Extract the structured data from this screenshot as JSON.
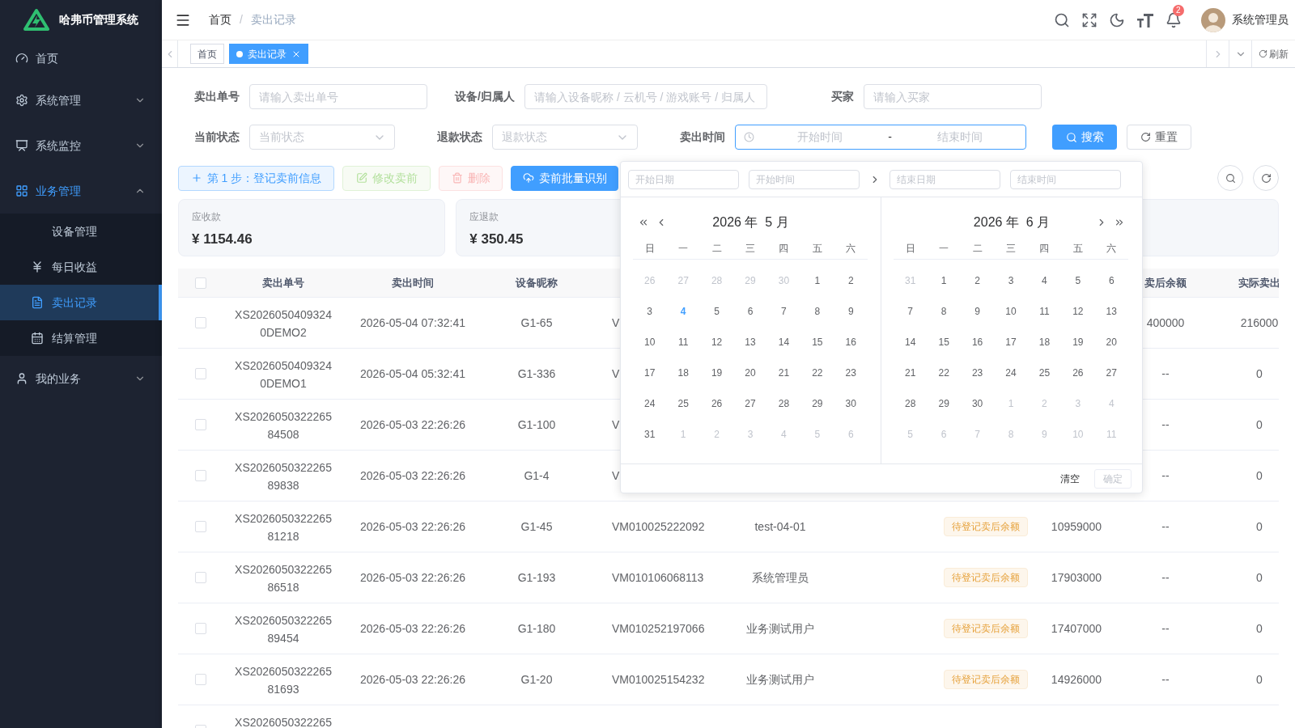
{
  "sidebar": {
    "title": "哈弗币管理系统",
    "items": [
      {
        "label": "首页",
        "selected": false
      },
      {
        "label": "系统管理",
        "selected": false,
        "expanded": false
      },
      {
        "label": "系统监控",
        "selected": false,
        "expanded": false
      },
      {
        "label": "业务管理",
        "selected": false,
        "expanded": true,
        "children": [
          {
            "label": "设备管理",
            "selected": false
          },
          {
            "label": "每日收益",
            "selected": false
          },
          {
            "label": "卖出记录",
            "selected": true
          },
          {
            "label": "结算管理",
            "selected": false
          }
        ]
      },
      {
        "label": "我的业务",
        "selected": false,
        "expanded": false
      }
    ]
  },
  "header": {
    "breadcrumb": [
      "首页",
      "卖出记录"
    ],
    "breadcrumb_separator": "/",
    "notifications": "2",
    "user": "系统管理员"
  },
  "tabs": [
    {
      "label": "首页",
      "selected": false
    },
    {
      "label": "卖出记录",
      "selected": true
    }
  ],
  "refresh": "刷新",
  "filters": [
    {
      "label": "卖出单号",
      "kind": "input",
      "placeholder": "请输入卖出单号"
    },
    {
      "label": "设备/归属人",
      "kind": "input",
      "placeholder": "请输入设备昵称 / 云机号 / 游戏账号 / 归属人"
    },
    {
      "label": "买家",
      "kind": "input",
      "placeholder": "请输入买家"
    },
    {
      "label": "当前状态",
      "kind": "select",
      "placeholder": "当前状态"
    },
    {
      "label": "退款状态",
      "kind": "select",
      "placeholder": "退款状态"
    },
    {
      "label": "卖出时间",
      "kind": "daterange",
      "start_placeholder": "开始时间",
      "separator": "-",
      "end_placeholder": "结束时间",
      "focused": true
    }
  ],
  "search_button": "搜索",
  "reset_button": "重置",
  "actions": [
    {
      "label": "第 1 步：登记卖前信息",
      "kind": "plain",
      "disabled": false
    },
    {
      "label": "修改卖前",
      "kind": "success",
      "disabled": true
    },
    {
      "label": "删除",
      "kind": "danger",
      "disabled": true
    },
    {
      "label": "卖前批量识别",
      "kind": "primary",
      "disabled": false
    }
  ],
  "stats": [
    {
      "kind": "value",
      "label": "应收款",
      "value": "¥ 1154.46"
    },
    {
      "kind": "value",
      "label": "应退款",
      "value": "¥ 350.45"
    },
    {
      "kind": "blank"
    }
  ],
  "table": {
    "columns": {
      "order_no": "卖出单号",
      "sale_time": "卖出时间",
      "device_name": "设备昵称",
      "balance_after_sale": "卖后余额",
      "column_9": "实际卖出"
    },
    "header_checked": false,
    "rows": [
      {
        "checked": false,
        "order_no": "XS20260504093240DEMO2",
        "sale_time": "2026-05-04 07:32:41",
        "device_name": "G1-65",
        "column_4": "V",
        "balance_after_sale": "400000",
        "column_9": "216000"
      },
      {
        "checked": false,
        "order_no": "XS20260504093240DEMO1",
        "sale_time": "2026-05-04 05:32:41",
        "device_name": "G1-336",
        "column_4": "V",
        "balance_after_sale": "--",
        "column_9": "0"
      },
      {
        "checked": false,
        "order_no": "XS202605032226584508",
        "sale_time": "2026-05-03 22:26:26",
        "device_name": "G1-100",
        "column_4": "V",
        "balance_after_sale": "--",
        "column_9": "0"
      },
      {
        "checked": false,
        "order_no": "XS202605032226589838",
        "sale_time": "2026-05-03 22:26:26",
        "device_name": "G1-4",
        "column_4": "V",
        "balance_after_sale": "--",
        "column_9": "0"
      },
      {
        "checked": false,
        "order_no": "XS202605032226581218",
        "sale_time": "2026-05-03 22:26:26",
        "device_name": "G1-45",
        "column_4": "VM010025222092",
        "column_5": "test-04-01",
        "column_6": "待登记卖后余额",
        "column_7": "10959000",
        "balance_after_sale": "--",
        "column_9": "0"
      },
      {
        "checked": false,
        "order_no": "XS202605032226586518",
        "sale_time": "2026-05-03 22:26:26",
        "device_name": "G1-193",
        "column_4": "VM010106068113",
        "column_5": "系统管理员",
        "column_6": "待登记卖后余额",
        "column_7": "17903000",
        "balance_after_sale": "--",
        "column_9": "0"
      },
      {
        "checked": false,
        "order_no": "XS202605032226589454",
        "sale_time": "2026-05-03 22:26:26",
        "device_name": "G1-180",
        "column_4": "VM010252197066",
        "column_5": "业务测试用户",
        "column_6": "待登记卖后余额",
        "column_7": "17407000",
        "balance_after_sale": "--",
        "column_9": "0"
      },
      {
        "checked": false,
        "order_no": "XS202605032226581693",
        "sale_time": "2026-05-03 22:26:26",
        "device_name": "G1-20",
        "column_4": "VM010025154232",
        "column_5": "业务测试用户",
        "column_6": "待登记卖后余额",
        "column_7": "14926000",
        "balance_after_sale": "--",
        "column_9": "0"
      },
      {
        "checked": false,
        "order_no": "XS2026050322265"
      }
    ]
  },
  "date_picker": {
    "start_date_placeholder": "开始日期",
    "start_time_placeholder": "开始时间",
    "end_date_placeholder": "结束日期",
    "end_time_placeholder": "结束时间",
    "clear": "清空",
    "confirm": {
      "label": "确定",
      "disabled": true
    },
    "months": [
      {
        "title": "2026 年  5 月",
        "weekdays": [
          "日",
          "一",
          "二",
          "三",
          "四",
          "五",
          "六"
        ],
        "weeks": [
          [
            {
              "label": "26",
              "muted": true,
              "today": false
            },
            {
              "label": "27",
              "muted": true,
              "today": false
            },
            {
              "label": "28",
              "muted": true,
              "today": false
            },
            {
              "label": "29",
              "muted": true,
              "today": false
            },
            {
              "label": "30",
              "muted": true,
              "today": false
            },
            {
              "label": "1",
              "muted": false,
              "today": false
            },
            {
              "label": "2",
              "muted": false,
              "today": false
            }
          ],
          [
            {
              "label": "3",
              "muted": false,
              "today": false
            },
            {
              "label": "4",
              "muted": false,
              "today": true
            },
            {
              "label": "5",
              "muted": false,
              "today": false
            },
            {
              "label": "6",
              "muted": false,
              "today": false
            },
            {
              "label": "7",
              "muted": false,
              "today": false
            },
            {
              "label": "8",
              "muted": false,
              "today": false
            },
            {
              "label": "9",
              "muted": false,
              "today": false
            }
          ],
          [
            {
              "label": "10",
              "muted": false,
              "today": false
            },
            {
              "label": "11",
              "muted": false,
              "today": false
            },
            {
              "label": "12",
              "muted": false,
              "today": false
            },
            {
              "label": "13",
              "muted": false,
              "today": false
            },
            {
              "label": "14",
              "muted": false,
              "today": false
            },
            {
              "label": "15",
              "muted": false,
              "today": false
            },
            {
              "label": "16",
              "muted": false,
              "today": false
            }
          ],
          [
            {
              "label": "17",
              "muted": false,
              "today": false
            },
            {
              "label": "18",
              "muted": false,
              "today": false
            },
            {
              "label": "19",
              "muted": false,
              "today": false
            },
            {
              "label": "20",
              "muted": false,
              "today": false
            },
            {
              "label": "21",
              "muted": false,
              "today": false
            },
            {
              "label": "22",
              "muted": false,
              "today": false
            },
            {
              "label": "23",
              "muted": false,
              "today": false
            }
          ],
          [
            {
              "label": "24",
              "muted": false,
              "today": false
            },
            {
              "label": "25",
              "muted": false,
              "today": false
            },
            {
              "label": "26",
              "muted": false,
              "today": false
            },
            {
              "label": "27",
              "muted": false,
              "today": false
            },
            {
              "label": "28",
              "muted": false,
              "today": false
            },
            {
              "label": "29",
              "muted": false,
              "today": false
            },
            {
              "label": "30",
              "muted": false,
              "today": false
            }
          ],
          [
            {
              "label": "31",
              "muted": false,
              "today": false
            },
            {
              "label": "1",
              "muted": true,
              "today": false
            },
            {
              "label": "2",
              "muted": true,
              "today": false
            },
            {
              "label": "3",
              "muted": true,
              "today": false
            },
            {
              "label": "4",
              "muted": true,
              "today": false
            },
            {
              "label": "5",
              "muted": true,
              "today": false
            },
            {
              "label": "6",
              "muted": true,
              "today": false
            }
          ]
        ]
      },
      {
        "title": "2026 年  6 月",
        "weekdays": [
          "日",
          "一",
          "二",
          "三",
          "四",
          "五",
          "六"
        ],
        "weeks": [
          [
            {
              "label": "31",
              "muted": true,
              "today": false
            },
            {
              "label": "1",
              "muted": false,
              "today": false
            },
            {
              "label": "2",
              "muted": false,
              "today": false
            },
            {
              "label": "3",
              "muted": false,
              "today": false
            },
            {
              "label": "4",
              "muted": false,
              "today": false
            },
            {
              "label": "5",
              "muted": false,
              "today": false
            },
            {
              "label": "6",
              "muted": false,
              "today": false
            }
          ],
          [
            {
              "label": "7",
              "muted": false,
              "today": false
            },
            {
              "label": "8",
              "muted": false,
              "today": false
            },
            {
              "label": "9",
              "muted": false,
              "today": false
            },
            {
              "label": "10",
              "muted": false,
              "today": false
            },
            {
              "label": "11",
              "muted": false,
              "today": false
            },
            {
              "label": "12",
              "muted": false,
              "today": false
            },
            {
              "label": "13",
              "muted": false,
              "today": false
            }
          ],
          [
            {
              "label": "14",
              "muted": false,
              "today": false
            },
            {
              "label": "15",
              "muted": false,
              "today": false
            },
            {
              "label": "16",
              "muted": false,
              "today": false
            },
            {
              "label": "17",
              "muted": false,
              "today": false
            },
            {
              "label": "18",
              "muted": false,
              "today": false
            },
            {
              "label": "19",
              "muted": false,
              "today": false
            },
            {
              "label": "20",
              "muted": false,
              "today": false
            }
          ],
          [
            {
              "label": "21",
              "muted": false,
              "today": false
            },
            {
              "label": "22",
              "muted": false,
              "today": false
            },
            {
              "label": "23",
              "muted": false,
              "today": false
            },
            {
              "label": "24",
              "muted": false,
              "today": false
            },
            {
              "label": "25",
              "muted": false,
              "today": false
            },
            {
              "label": "26",
              "muted": false,
              "today": false
            },
            {
              "label": "27",
              "muted": false,
              "today": false
            }
          ],
          [
            {
              "label": "28",
              "muted": false,
              "today": false
            },
            {
              "label": "29",
              "muted": false,
              "today": false
            },
            {
              "label": "30",
              "muted": false,
              "today": false
            },
            {
              "label": "1",
              "muted": true,
              "today": false
            },
            {
              "label": "2",
              "muted": true,
              "today": false
            },
            {
              "label": "3",
              "muted": true,
              "today": false
            },
            {
              "label": "4",
              "muted": true,
              "today": false
            }
          ],
          [
            {
              "label": "5",
              "muted": true,
              "today": false
            },
            {
              "label": "6",
              "muted": true,
              "today": false
            },
            {
              "label": "7",
              "muted": true,
              "today": false
            },
            {
              "label": "8",
              "muted": true,
              "today": false
            },
            {
              "label": "9",
              "muted": true,
              "today": false
            },
            {
              "label": "10",
              "muted": true,
              "today": false
            },
            {
              "label": "11",
              "muted": true,
              "today": false
            }
          ]
        ]
      }
    ]
  }
}
